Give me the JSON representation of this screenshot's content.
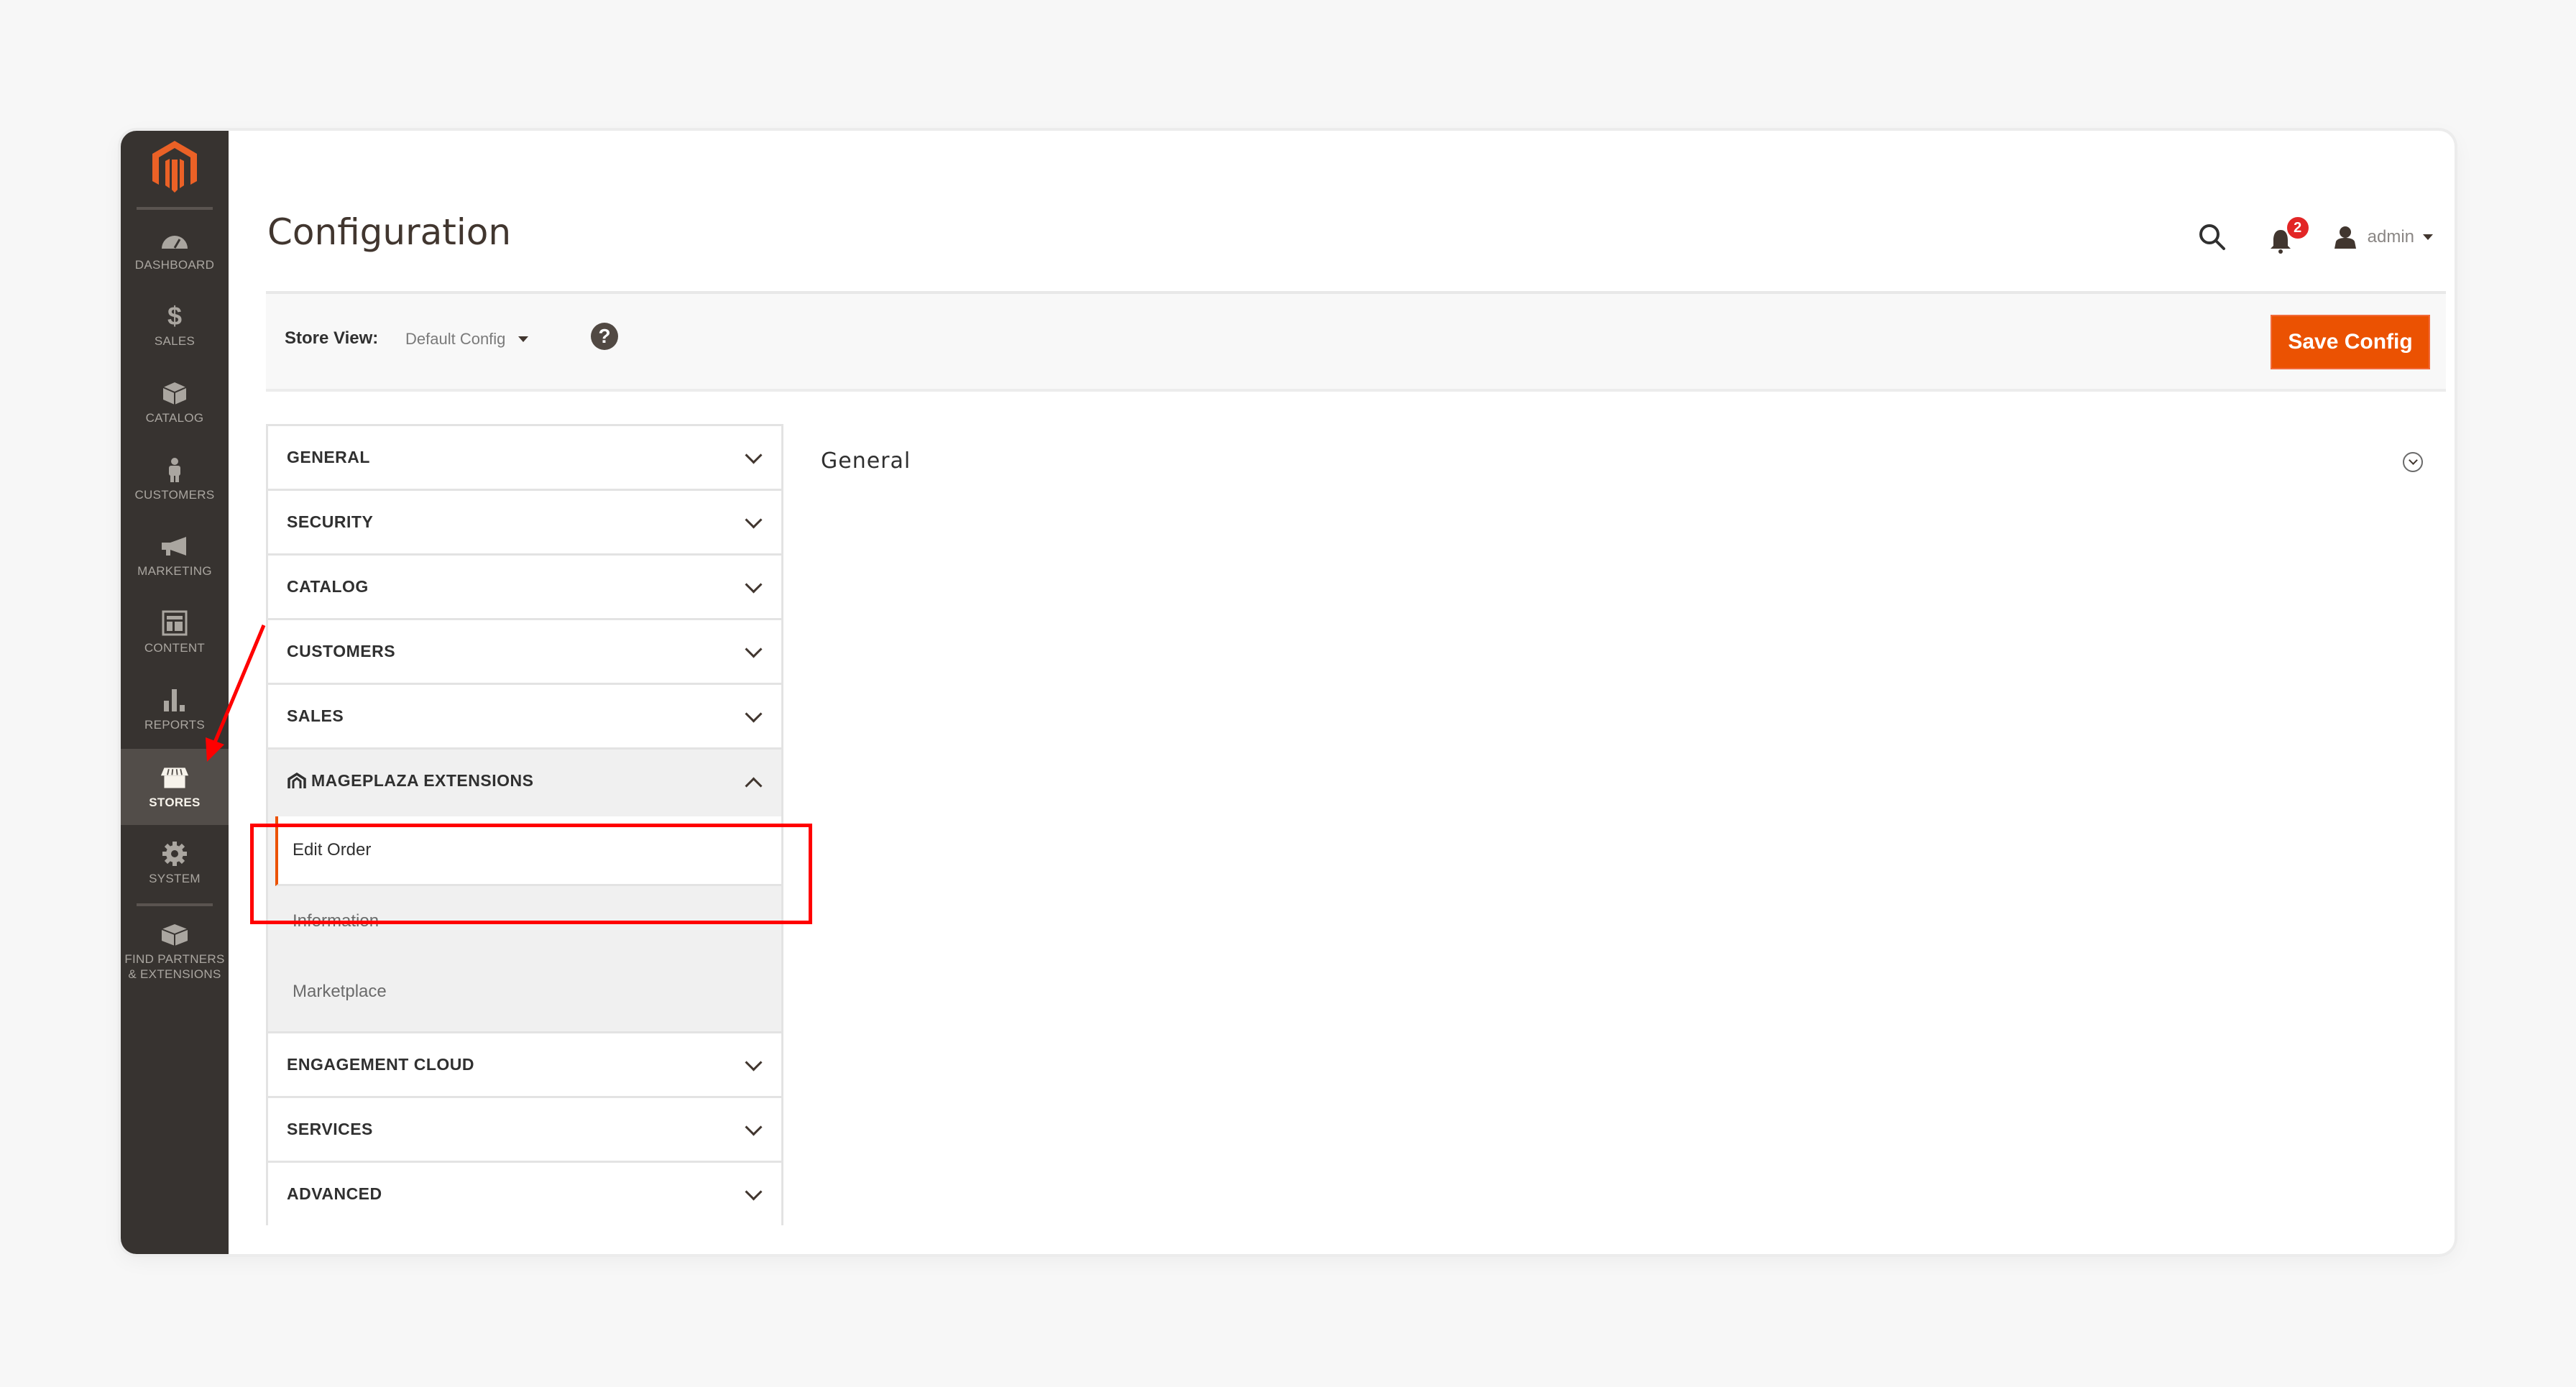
{
  "sidebar": {
    "logo": "magento-logo",
    "items": [
      {
        "label": "Dashboard",
        "icon": "dashboard-icon",
        "active": false
      },
      {
        "label": "Sales",
        "icon": "dollar-icon",
        "active": false
      },
      {
        "label": "Catalog",
        "icon": "box-icon",
        "active": false
      },
      {
        "label": "Customers",
        "icon": "person-icon",
        "active": false
      },
      {
        "label": "Marketing",
        "icon": "megaphone-icon",
        "active": false
      },
      {
        "label": "Content",
        "icon": "layout-icon",
        "active": false
      },
      {
        "label": "Reports",
        "icon": "bar-chart-icon",
        "active": false
      },
      {
        "label": "Stores",
        "icon": "storefront-icon",
        "active": true
      },
      {
        "label": "System",
        "icon": "gear-icon",
        "active": false
      },
      {
        "label": "Find Partners & Extensions",
        "icon": "lego-block-icon",
        "active": false
      }
    ]
  },
  "header": {
    "title": "Configuration",
    "notifications_count": "2",
    "user_name": "admin"
  },
  "store_view": {
    "label": "Store View:",
    "selected": "Default Config",
    "help": "?"
  },
  "toolbar": {
    "save_label": "Save Config"
  },
  "tabs": {
    "items_before": [
      {
        "label": "GENERAL"
      },
      {
        "label": "SECURITY"
      },
      {
        "label": "CATALOG"
      },
      {
        "label": "CUSTOMERS"
      },
      {
        "label": "SALES"
      }
    ],
    "open_tab": {
      "label": "MAGEPLAZA EXTENSIONS",
      "subitems": [
        {
          "label": "Edit Order",
          "active": true
        },
        {
          "label": "Information",
          "active": false
        },
        {
          "label": "Marketplace",
          "active": false
        }
      ]
    },
    "items_after": [
      {
        "label": "ENGAGEMENT CLOUD"
      },
      {
        "label": "SERVICES"
      },
      {
        "label": "ADVANCED"
      }
    ]
  },
  "main": {
    "section_title": "General"
  },
  "colors": {
    "accent": "#eb5202",
    "sidebar_bg": "#373330",
    "sidebar_active_bg": "#524d49",
    "annotation": "#ff0000",
    "badge": "#e22626"
  }
}
